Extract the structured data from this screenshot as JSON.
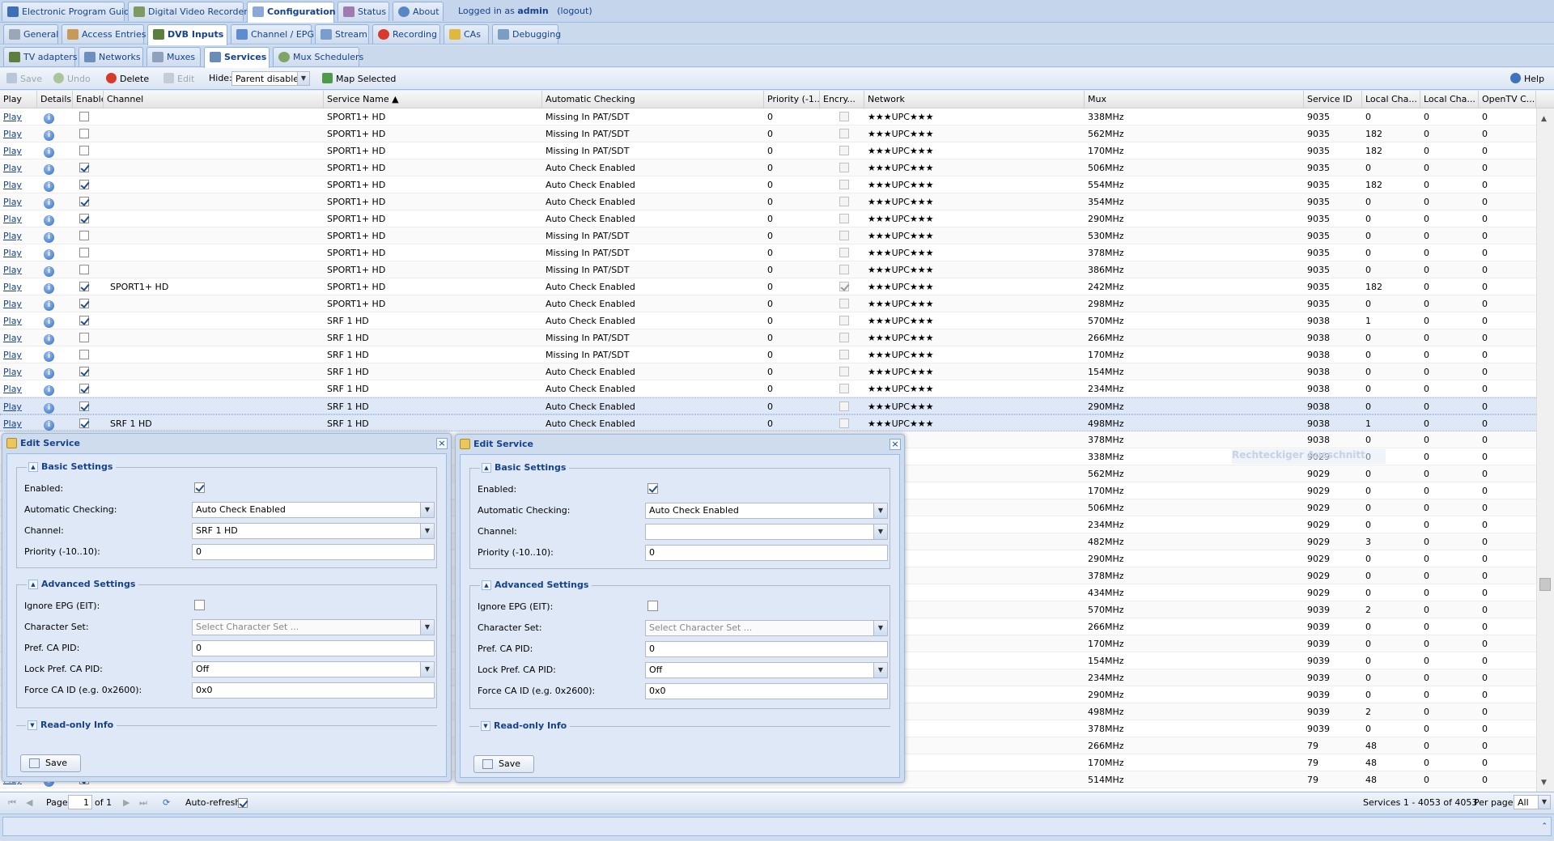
{
  "top_tabs": [
    {
      "label": "Electronic Program Guide",
      "icon": "epg-icon",
      "active": false
    },
    {
      "label": "Digital Video Recorder",
      "icon": "dvr-icon",
      "active": false
    },
    {
      "label": "Configuration",
      "icon": "wrench-icon",
      "active": true
    },
    {
      "label": "Status",
      "icon": "status-icon",
      "active": false
    },
    {
      "label": "About",
      "icon": "about-icon",
      "active": false
    }
  ],
  "login": {
    "prefix": "Logged in as",
    "user": "admin",
    "logout": "(logout)"
  },
  "config_tabs": [
    {
      "label": "General",
      "active": false
    },
    {
      "label": "Access Entries",
      "active": false
    },
    {
      "label": "DVB Inputs",
      "active": true
    },
    {
      "label": "Channel / EPG",
      "active": false
    },
    {
      "label": "Stream",
      "active": false
    },
    {
      "label": "Recording",
      "active": false
    },
    {
      "label": "CAs",
      "active": false
    },
    {
      "label": "Debugging",
      "active": false
    }
  ],
  "dvb_tabs": [
    {
      "label": "TV adapters",
      "active": false
    },
    {
      "label": "Networks",
      "active": false
    },
    {
      "label": "Muxes",
      "active": false
    },
    {
      "label": "Services",
      "active": true
    },
    {
      "label": "Mux Schedulers",
      "active": false
    }
  ],
  "toolbar": {
    "save": "Save",
    "undo": "Undo",
    "delete": "Delete",
    "edit": "Edit",
    "hide_label": "Hide:",
    "hide_value": "Parent disabled",
    "map": "Map Selected",
    "help": "Help"
  },
  "columns": [
    "Play",
    "Details",
    "Enabled",
    "Channel",
    "Service Name ▲",
    "Automatic Checking",
    "Priority (-1...",
    "Encry...",
    "Network",
    "Mux",
    "Service ID",
    "Local Cha...",
    "Local Cha...",
    "OpenTV C..."
  ],
  "play_label": "Play",
  "rows": [
    {
      "en": false,
      "ch": "",
      "svc": "SPORT1+ HD",
      "ac": "Missing In PAT/SDT",
      "pr": "0",
      "enc": false,
      "net": "★★★UPC★★★",
      "mux": "338MHz",
      "sid": "9035",
      "lc1": "0",
      "lc2": "0",
      "otv": "0"
    },
    {
      "en": false,
      "ch": "",
      "svc": "SPORT1+ HD",
      "ac": "Missing In PAT/SDT",
      "pr": "0",
      "enc": false,
      "net": "★★★UPC★★★",
      "mux": "562MHz",
      "sid": "9035",
      "lc1": "182",
      "lc2": "0",
      "otv": "0"
    },
    {
      "en": false,
      "ch": "",
      "svc": "SPORT1+ HD",
      "ac": "Missing In PAT/SDT",
      "pr": "0",
      "enc": false,
      "net": "★★★UPC★★★",
      "mux": "170MHz",
      "sid": "9035",
      "lc1": "182",
      "lc2": "0",
      "otv": "0"
    },
    {
      "en": true,
      "ch": "",
      "svc": "SPORT1+ HD",
      "ac": "Auto Check Enabled",
      "pr": "0",
      "enc": false,
      "net": "★★★UPC★★★",
      "mux": "506MHz",
      "sid": "9035",
      "lc1": "0",
      "lc2": "0",
      "otv": "0"
    },
    {
      "en": true,
      "ch": "",
      "svc": "SPORT1+ HD",
      "ac": "Auto Check Enabled",
      "pr": "0",
      "enc": false,
      "net": "★★★UPC★★★",
      "mux": "554MHz",
      "sid": "9035",
      "lc1": "182",
      "lc2": "0",
      "otv": "0"
    },
    {
      "en": true,
      "ch": "",
      "svc": "SPORT1+ HD",
      "ac": "Auto Check Enabled",
      "pr": "0",
      "enc": false,
      "net": "★★★UPC★★★",
      "mux": "354MHz",
      "sid": "9035",
      "lc1": "0",
      "lc2": "0",
      "otv": "0"
    },
    {
      "en": true,
      "ch": "",
      "svc": "SPORT1+ HD",
      "ac": "Auto Check Enabled",
      "pr": "0",
      "enc": false,
      "net": "★★★UPC★★★",
      "mux": "290MHz",
      "sid": "9035",
      "lc1": "0",
      "lc2": "0",
      "otv": "0"
    },
    {
      "en": false,
      "ch": "",
      "svc": "SPORT1+ HD",
      "ac": "Missing In PAT/SDT",
      "pr": "0",
      "enc": false,
      "net": "★★★UPC★★★",
      "mux": "530MHz",
      "sid": "9035",
      "lc1": "0",
      "lc2": "0",
      "otv": "0"
    },
    {
      "en": false,
      "ch": "",
      "svc": "SPORT1+ HD",
      "ac": "Missing In PAT/SDT",
      "pr": "0",
      "enc": false,
      "net": "★★★UPC★★★",
      "mux": "378MHz",
      "sid": "9035",
      "lc1": "0",
      "lc2": "0",
      "otv": "0"
    },
    {
      "en": false,
      "ch": "",
      "svc": "SPORT1+ HD",
      "ac": "Missing In PAT/SDT",
      "pr": "0",
      "enc": false,
      "net": "★★★UPC★★★",
      "mux": "386MHz",
      "sid": "9035",
      "lc1": "0",
      "lc2": "0",
      "otv": "0"
    },
    {
      "en": true,
      "ch": "SPORT1+ HD",
      "svc": "SPORT1+ HD",
      "ac": "Auto Check Enabled",
      "pr": "0",
      "enc": true,
      "net": "★★★UPC★★★",
      "mux": "242MHz",
      "sid": "9035",
      "lc1": "182",
      "lc2": "0",
      "otv": "0"
    },
    {
      "en": true,
      "ch": "",
      "svc": "SPORT1+ HD",
      "ac": "Auto Check Enabled",
      "pr": "0",
      "enc": false,
      "net": "★★★UPC★★★",
      "mux": "298MHz",
      "sid": "9035",
      "lc1": "0",
      "lc2": "0",
      "otv": "0"
    },
    {
      "en": true,
      "ch": "",
      "svc": "SRF 1 HD",
      "ac": "Auto Check Enabled",
      "pr": "0",
      "enc": false,
      "net": "★★★UPC★★★",
      "mux": "570MHz",
      "sid": "9038",
      "lc1": "1",
      "lc2": "0",
      "otv": "0"
    },
    {
      "en": false,
      "ch": "",
      "svc": "SRF 1 HD",
      "ac": "Missing In PAT/SDT",
      "pr": "0",
      "enc": false,
      "net": "★★★UPC★★★",
      "mux": "266MHz",
      "sid": "9038",
      "lc1": "0",
      "lc2": "0",
      "otv": "0"
    },
    {
      "en": false,
      "ch": "",
      "svc": "SRF 1 HD",
      "ac": "Missing In PAT/SDT",
      "pr": "0",
      "enc": false,
      "net": "★★★UPC★★★",
      "mux": "170MHz",
      "sid": "9038",
      "lc1": "0",
      "lc2": "0",
      "otv": "0"
    },
    {
      "en": true,
      "ch": "",
      "svc": "SRF 1 HD",
      "ac": "Auto Check Enabled",
      "pr": "0",
      "enc": false,
      "net": "★★★UPC★★★",
      "mux": "154MHz",
      "sid": "9038",
      "lc1": "0",
      "lc2": "0",
      "otv": "0"
    },
    {
      "en": true,
      "ch": "",
      "svc": "SRF 1 HD",
      "ac": "Auto Check Enabled",
      "pr": "0",
      "enc": false,
      "net": "★★★UPC★★★",
      "mux": "234MHz",
      "sid": "9038",
      "lc1": "0",
      "lc2": "0",
      "otv": "0"
    },
    {
      "en": true,
      "ch": "",
      "svc": "SRF 1 HD",
      "ac": "Auto Check Enabled",
      "pr": "0",
      "enc": false,
      "net": "★★★UPC★★★",
      "mux": "290MHz",
      "sid": "9038",
      "lc1": "0",
      "lc2": "0",
      "otv": "0",
      "sel": true
    },
    {
      "en": true,
      "ch": "SRF 1 HD",
      "svc": "SRF 1 HD",
      "ac": "Auto Check Enabled",
      "pr": "0",
      "enc": false,
      "net": "★★★UPC★★★",
      "mux": "498MHz",
      "sid": "9038",
      "lc1": "1",
      "lc2": "0",
      "otv": "0",
      "sel": true
    },
    {
      "en": true,
      "ch": "",
      "svc": "",
      "ac": "",
      "pr": "",
      "enc": false,
      "net": "★★★",
      "mux": "378MHz",
      "sid": "9038",
      "lc1": "0",
      "lc2": "0",
      "otv": "0"
    },
    {
      "en": true,
      "ch": "",
      "svc": "",
      "ac": "",
      "pr": "",
      "enc": false,
      "net": "★★★",
      "mux": "338MHz",
      "sid": "9029",
      "lc1": "0",
      "lc2": "0",
      "otv": "0"
    },
    {
      "en": true,
      "ch": "",
      "svc": "",
      "ac": "",
      "pr": "",
      "enc": false,
      "net": "★★★",
      "mux": "562MHz",
      "sid": "9029",
      "lc1": "0",
      "lc2": "0",
      "otv": "0"
    },
    {
      "en": true,
      "ch": "",
      "svc": "",
      "ac": "",
      "pr": "",
      "enc": false,
      "net": "★★★",
      "mux": "170MHz",
      "sid": "9029",
      "lc1": "0",
      "lc2": "0",
      "otv": "0"
    },
    {
      "en": true,
      "ch": "",
      "svc": "",
      "ac": "",
      "pr": "",
      "enc": false,
      "net": "★★★",
      "mux": "506MHz",
      "sid": "9029",
      "lc1": "0",
      "lc2": "0",
      "otv": "0"
    },
    {
      "en": true,
      "ch": "",
      "svc": "",
      "ac": "",
      "pr": "",
      "enc": false,
      "net": "★★★",
      "mux": "234MHz",
      "sid": "9029",
      "lc1": "0",
      "lc2": "0",
      "otv": "0"
    },
    {
      "en": true,
      "ch": "",
      "svc": "",
      "ac": "",
      "pr": "",
      "enc": false,
      "net": "★★★",
      "mux": "482MHz",
      "sid": "9029",
      "lc1": "3",
      "lc2": "0",
      "otv": "0"
    },
    {
      "en": true,
      "ch": "",
      "svc": "",
      "ac": "",
      "pr": "",
      "enc": false,
      "net": "★★★",
      "mux": "290MHz",
      "sid": "9029",
      "lc1": "0",
      "lc2": "0",
      "otv": "0"
    },
    {
      "en": true,
      "ch": "",
      "svc": "",
      "ac": "",
      "pr": "",
      "enc": false,
      "net": "★★★",
      "mux": "378MHz",
      "sid": "9029",
      "lc1": "0",
      "lc2": "0",
      "otv": "0"
    },
    {
      "en": true,
      "ch": "",
      "svc": "",
      "ac": "",
      "pr": "",
      "enc": false,
      "net": "★★★",
      "mux": "434MHz",
      "sid": "9029",
      "lc1": "0",
      "lc2": "0",
      "otv": "0"
    },
    {
      "en": true,
      "ch": "",
      "svc": "",
      "ac": "",
      "pr": "",
      "enc": false,
      "net": "★★★",
      "mux": "570MHz",
      "sid": "9039",
      "lc1": "2",
      "lc2": "0",
      "otv": "0"
    },
    {
      "en": true,
      "ch": "",
      "svc": "",
      "ac": "",
      "pr": "",
      "enc": false,
      "net": "★★★",
      "mux": "266MHz",
      "sid": "9039",
      "lc1": "0",
      "lc2": "0",
      "otv": "0"
    },
    {
      "en": true,
      "ch": "",
      "svc": "",
      "ac": "",
      "pr": "",
      "enc": false,
      "net": "★★★",
      "mux": "170MHz",
      "sid": "9039",
      "lc1": "0",
      "lc2": "0",
      "otv": "0"
    },
    {
      "en": true,
      "ch": "",
      "svc": "",
      "ac": "",
      "pr": "",
      "enc": false,
      "net": "★★★",
      "mux": "154MHz",
      "sid": "9039",
      "lc1": "0",
      "lc2": "0",
      "otv": "0"
    },
    {
      "en": true,
      "ch": "",
      "svc": "",
      "ac": "",
      "pr": "",
      "enc": false,
      "net": "★★★",
      "mux": "234MHz",
      "sid": "9039",
      "lc1": "0",
      "lc2": "0",
      "otv": "0"
    },
    {
      "en": true,
      "ch": "",
      "svc": "",
      "ac": "",
      "pr": "",
      "enc": false,
      "net": "★★★",
      "mux": "290MHz",
      "sid": "9039",
      "lc1": "0",
      "lc2": "0",
      "otv": "0"
    },
    {
      "en": true,
      "ch": "",
      "svc": "",
      "ac": "",
      "pr": "",
      "enc": false,
      "net": "★★★",
      "mux": "498MHz",
      "sid": "9039",
      "lc1": "2",
      "lc2": "0",
      "otv": "0"
    },
    {
      "en": true,
      "ch": "",
      "svc": "",
      "ac": "",
      "pr": "",
      "enc": false,
      "net": "★★★",
      "mux": "378MHz",
      "sid": "9039",
      "lc1": "0",
      "lc2": "0",
      "otv": "0"
    },
    {
      "en": true,
      "ch": "",
      "svc": "",
      "ac": "",
      "pr": "",
      "enc": false,
      "net": "★★★",
      "mux": "266MHz",
      "sid": "79",
      "lc1": "48",
      "lc2": "0",
      "otv": "0"
    },
    {
      "en": true,
      "ch": "",
      "svc": "",
      "ac": "",
      "pr": "",
      "enc": false,
      "net": "★★★",
      "mux": "170MHz",
      "sid": "79",
      "lc1": "48",
      "lc2": "0",
      "otv": "0"
    },
    {
      "en": true,
      "ch": "",
      "svc": "",
      "ac": "",
      "pr": "",
      "enc": false,
      "net": "★★★",
      "mux": "514MHz",
      "sid": "79",
      "lc1": "48",
      "lc2": "0",
      "otv": "0"
    }
  ],
  "ghost_text": "Rechteckiger Ausschnitt",
  "dialogs": [
    {
      "title": "Edit Service",
      "basic": "Basic Settings",
      "advanced": "Advanced Settings",
      "readonly": "Read-only Info",
      "enabled_label": "Enabled:",
      "enabled": true,
      "autocheck_label": "Automatic Checking:",
      "autocheck": "Auto Check Enabled",
      "channel_label": "Channel:",
      "channel": "SRF 1 HD",
      "priority_label": "Priority (-10..10):",
      "priority": "0",
      "ignore_epg_label": "Ignore EPG (EIT):",
      "ignore_epg": false,
      "charset_label": "Character Set:",
      "charset": "Select Character Set ...",
      "pref_ca_label": "Pref. CA PID:",
      "pref_ca": "0",
      "lock_ca_label": "Lock Pref. CA PID:",
      "lock_ca": "Off",
      "force_ca_label": "Force CA ID (e.g. 0x2600):",
      "force_ca": "0x0",
      "save": "Save"
    },
    {
      "title": "Edit Service",
      "basic": "Basic Settings",
      "advanced": "Advanced Settings",
      "readonly": "Read-only Info",
      "enabled_label": "Enabled:",
      "enabled": true,
      "autocheck_label": "Automatic Checking:",
      "autocheck": "Auto Check Enabled",
      "channel_label": "Channel:",
      "channel": "",
      "priority_label": "Priority (-10..10):",
      "priority": "0",
      "ignore_epg_label": "Ignore EPG (EIT):",
      "ignore_epg": false,
      "charset_label": "Character Set:",
      "charset": "Select Character Set ...",
      "pref_ca_label": "Pref. CA PID:",
      "pref_ca": "0",
      "lock_ca_label": "Lock Pref. CA PID:",
      "lock_ca": "Off",
      "force_ca_label": "Force CA ID (e.g. 0x2600):",
      "force_ca": "0x0",
      "save": "Save"
    }
  ],
  "paging": {
    "page_label": "Page",
    "page": "1",
    "of": "of 1",
    "autorefresh": "Auto-refresh",
    "autorefresh_on": true,
    "summary": "Services 1 - 4053 of 4053",
    "perpage_label": "Per page",
    "perpage": "All"
  }
}
